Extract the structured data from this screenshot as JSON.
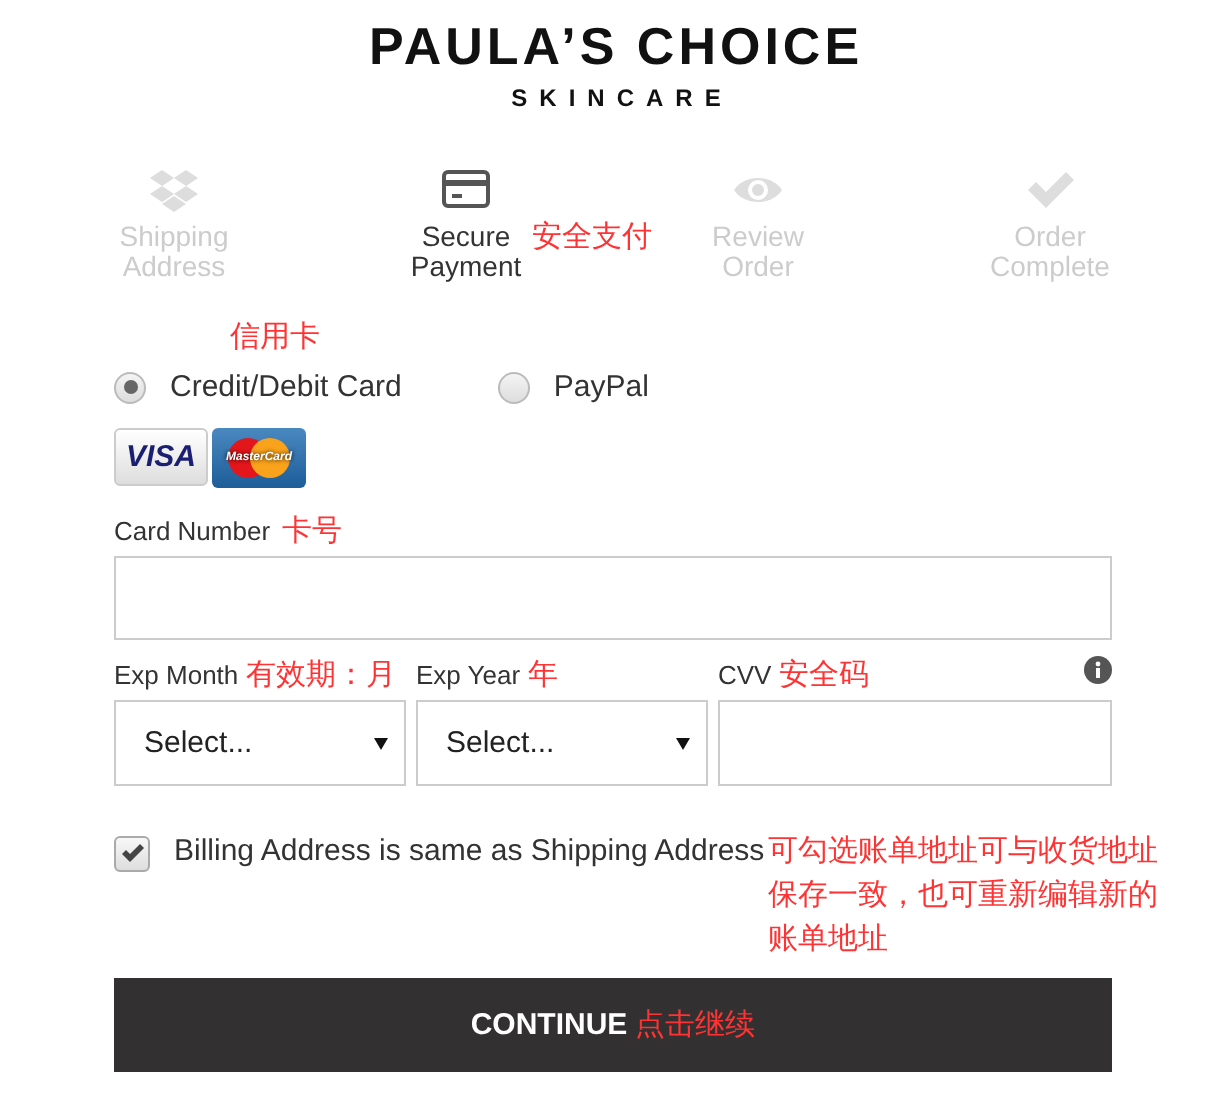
{
  "logo": {
    "title": "PAULA’S CHOICE",
    "subtitle": "SKINCARE"
  },
  "steps": [
    {
      "kind": "boxes",
      "label": "Shipping Address",
      "selected": false
    },
    {
      "kind": "card",
      "label": "Secure Payment",
      "selected": true,
      "annotation": "安全支付"
    },
    {
      "kind": "eye",
      "label": "Review Order",
      "selected": false
    },
    {
      "kind": "check",
      "label": "Order Complete",
      "selected": false
    }
  ],
  "payment_methods": [
    {
      "label": "Credit/Debit Card",
      "selected": true,
      "annotation": "信用卡"
    },
    {
      "label": "PayPal",
      "selected": false
    }
  ],
  "card_logos": [
    {
      "kind": "visa",
      "text": "VISA"
    },
    {
      "kind": "mastercard",
      "text": "MasterCard"
    }
  ],
  "card_number": {
    "label": "Card Number",
    "annotation": "卡号"
  },
  "expiry_fields": [
    {
      "kind": "select",
      "label": "Exp Month",
      "annotation": "有效期：月",
      "value": "Select..."
    },
    {
      "kind": "select",
      "label": "Exp Year",
      "annotation": "年",
      "value": "Select..."
    },
    {
      "kind": "input",
      "label": "CVV",
      "annotation": "安全码",
      "info": true
    }
  ],
  "billing": {
    "label": "Billing Address is same as Shipping Address",
    "checked": true,
    "annotation": "可勾选账单地址可与收货地址保存一致，也可重新编辑新的账单地址"
  },
  "continue_button": {
    "label": "CONTINUE",
    "annotation": "点击继续"
  }
}
